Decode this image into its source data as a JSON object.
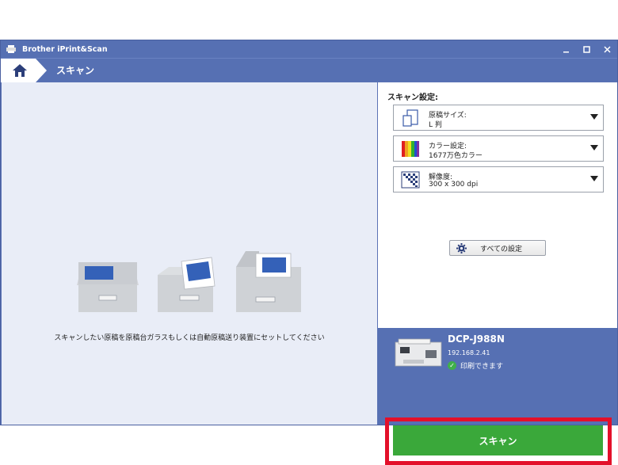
{
  "window": {
    "title": "Brother iPrint&Scan"
  },
  "nav": {
    "title": "スキャン"
  },
  "preview": {
    "instruction": "スキャンしたい原稿を原稿台ガラスもしくは自動原稿送り装置にセットしてください"
  },
  "settings": {
    "heading": "スキャン設定:",
    "items": [
      {
        "label": "原稿サイズ:",
        "value": "L 判",
        "icon": "paper-size-icon"
      },
      {
        "label": "カラー設定:",
        "value": "1677万色カラー",
        "icon": "color-setting-icon"
      },
      {
        "label": "解像度:",
        "value": "300 x 300 dpi",
        "icon": "resolution-icon"
      }
    ],
    "all_settings_label": "すべての設定"
  },
  "device": {
    "name": "DCP-J988N",
    "ip": "192.168.2.41",
    "status": "印刷できます"
  },
  "scan_button_label": "スキャン",
  "colors": {
    "accent": "#5670b3",
    "scan_green": "#3aa83a",
    "highlight_red": "#e3102a"
  }
}
